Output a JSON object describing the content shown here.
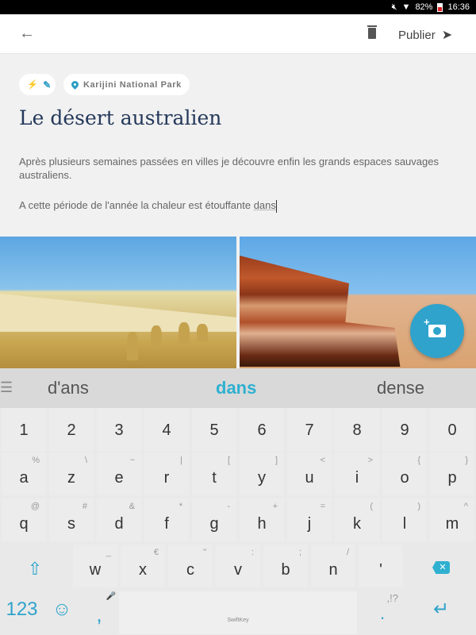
{
  "status_bar": {
    "battery": "82%",
    "time": "16:36"
  },
  "app_bar": {
    "back_icon": "←",
    "delete_icon": "trash",
    "publish_label": "Publier",
    "send_icon": "➤"
  },
  "chips": {
    "edit_icons": [
      "⚡",
      "✎"
    ],
    "location": "Karijini National Park"
  },
  "post": {
    "title": "Le désert australien",
    "paragraph1": "Après plusieurs semaines passées en villes je découvre enfin les grands espaces sauvages australiens.",
    "paragraph2_prefix": "A cette période de l'année la chaleur est étouffante ",
    "paragraph2_current_word": "dans"
  },
  "photos": [
    {
      "description": "Pinnacles sand dunes under blue sky"
    },
    {
      "description": "Layered red rock formation in desert"
    }
  ],
  "fab": {
    "icon": "add-photo-icon"
  },
  "keyboard": {
    "menu_icon": "☰",
    "suggestions": [
      "d'ans",
      "dans",
      "dense"
    ],
    "number_row": [
      "1",
      "2",
      "3",
      "4",
      "5",
      "6",
      "7",
      "8",
      "9",
      "0"
    ],
    "row1": [
      {
        "k": "a",
        "alt": "%"
      },
      {
        "k": "z",
        "alt": "\\"
      },
      {
        "k": "e",
        "alt": "~"
      },
      {
        "k": "r",
        "alt": "|"
      },
      {
        "k": "t",
        "alt": "["
      },
      {
        "k": "y",
        "alt": "]"
      },
      {
        "k": "u",
        "alt": "<"
      },
      {
        "k": "i",
        "alt": ">"
      },
      {
        "k": "o",
        "alt": "{"
      },
      {
        "k": "p",
        "alt": "}"
      }
    ],
    "row2": [
      {
        "k": "q",
        "alt": "@"
      },
      {
        "k": "s",
        "alt": "#"
      },
      {
        "k": "d",
        "alt": "&"
      },
      {
        "k": "f",
        "alt": "*"
      },
      {
        "k": "g",
        "alt": "-"
      },
      {
        "k": "h",
        "alt": "+"
      },
      {
        "k": "j",
        "alt": "="
      },
      {
        "k": "k",
        "alt": "("
      },
      {
        "k": "l",
        "alt": ")"
      },
      {
        "k": "m",
        "alt": "^"
      }
    ],
    "row3": [
      {
        "k": "w",
        "alt": "_"
      },
      {
        "k": "x",
        "alt": "€"
      },
      {
        "k": "c",
        "alt": "\""
      },
      {
        "k": "v",
        "alt": ":"
      },
      {
        "k": "b",
        "alt": ";"
      },
      {
        "k": "n",
        "alt": "/"
      },
      {
        "k": "'",
        "alt": ""
      }
    ],
    "shift_icon": "⇧",
    "backspace_icon": "✕",
    "numbers_label": "123",
    "emoji_icon": "☺",
    "comma": ",",
    "mic_icon": "🎤",
    "space_brand": "SwiftKey",
    "period": ".",
    "period_alt": ",!?",
    "enter_icon": "↵"
  }
}
